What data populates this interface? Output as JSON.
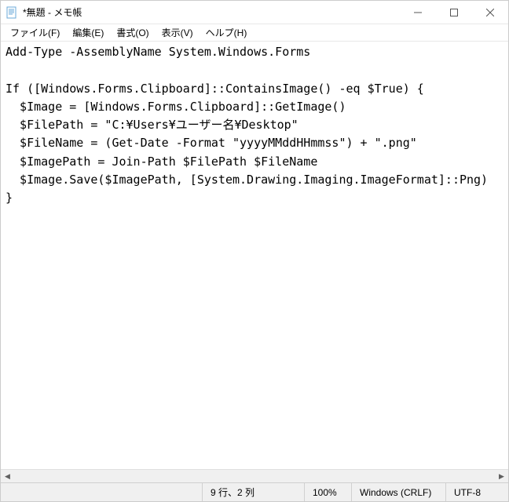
{
  "window": {
    "title": "*無題 - メモ帳"
  },
  "menubar": {
    "items": [
      {
        "label": "ファイル(F)"
      },
      {
        "label": "編集(E)"
      },
      {
        "label": "書式(O)"
      },
      {
        "label": "表示(V)"
      },
      {
        "label": "ヘルプ(H)"
      }
    ]
  },
  "content": {
    "text": "Add-Type -AssemblyName System.Windows.Forms\n\nIf ([Windows.Forms.Clipboard]::ContainsImage() -eq $True) {\n  $Image = [Windows.Forms.Clipboard]::GetImage()\n  $FilePath = \"C:¥Users¥ユーザー名¥Desktop\"\n  $FileName = (Get-Date -Format \"yyyyMMddHHmmss\") + \".png\"\n  $ImagePath = Join-Path $FilePath $FileName\n  $Image.Save($ImagePath, [System.Drawing.Imaging.ImageFormat]::Png)\n}"
  },
  "statusbar": {
    "cursor": "9 行、2 列",
    "zoom": "100%",
    "line_ending": "Windows (CRLF)",
    "encoding": "UTF-8"
  }
}
